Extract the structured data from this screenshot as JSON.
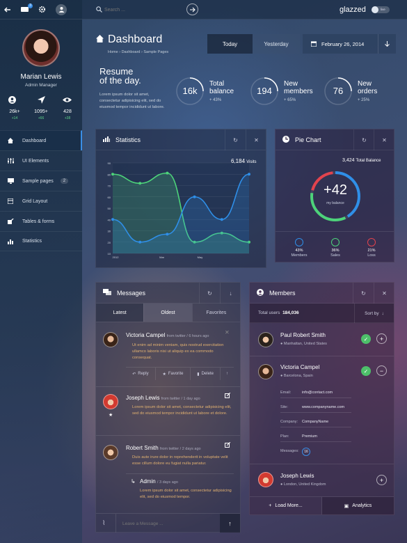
{
  "header": {
    "search_placeholder": "Search ...",
    "brand": "glazzed",
    "toggle": "live"
  },
  "sidebar": {
    "notification_count": "3",
    "user": {
      "name": "Marian Lewis",
      "role": "Admin Manager"
    },
    "stats": [
      {
        "value": "26k+",
        "delta": "+14"
      },
      {
        "value": "1095+",
        "delta": "+66"
      },
      {
        "value": "428",
        "delta": "+38"
      }
    ],
    "menu": [
      {
        "label": "Dashboard",
        "active": true
      },
      {
        "label": "UI Elements"
      },
      {
        "label": "Sample pages",
        "badge": "2"
      },
      {
        "label": "Grid Layout"
      },
      {
        "label": "Tables & forms"
      },
      {
        "label": "Statistics"
      }
    ]
  },
  "page": {
    "title": "Dashboard",
    "breadcrumb": [
      "Home",
      "Dashboard",
      "Sample Pages"
    ]
  },
  "date_tabs": {
    "today": "Today",
    "yesterday": "Yesterday",
    "date": "February 26, 2014"
  },
  "resume": {
    "title_1": "Resume",
    "title_2": "of the day.",
    "text": "Lorem ipsum dolor sit amet, consectetur adipisicing elit, sed do eiusmod tempor incididunt ut labore."
  },
  "kpis": [
    {
      "value": "16k",
      "label_1": "Total",
      "label_2": "balance",
      "delta": "+ 43%"
    },
    {
      "value": "194",
      "label_1": "New",
      "label_2": "members",
      "delta": "+ 65%"
    },
    {
      "value": "76",
      "label_1": "New",
      "label_2": "orders",
      "delta": "+ 25%"
    }
  ],
  "statistics": {
    "title": "Statistics",
    "visits_value": "6,184",
    "visits_label": "Visits"
  },
  "chart_data": {
    "type": "area",
    "title": "",
    "xlabel": "",
    "ylabel": "",
    "ylim": [
      10,
      90
    ],
    "yticks": [
      10,
      20,
      30,
      40,
      50,
      60,
      70,
      80,
      90
    ],
    "x_tick_labels": [
      "2012",
      "Mar",
      "May"
    ],
    "x": [
      0,
      1,
      2,
      3,
      4,
      5
    ],
    "series": [
      {
        "name": "",
        "color": "#4dd37a",
        "values": [
          80,
          72,
          81,
          20,
          28,
          20
        ]
      },
      {
        "name": "",
        "color": "#2f8fe8",
        "values": [
          40,
          20,
          27,
          60,
          40,
          80
        ]
      }
    ],
    "grid": true
  },
  "pie": {
    "title": "Pie Chart",
    "total_value": "3,424",
    "total_label": "Total Balance",
    "center_value": "+42",
    "center_label": "my balance",
    "segments": [
      {
        "name": "Members",
        "percent": 43,
        "color": "#2f8fe8"
      },
      {
        "name": "Sales",
        "percent": 36,
        "color": "#4dd37a"
      },
      {
        "name": "Loss",
        "percent": 21,
        "color": "#e2434d"
      }
    ],
    "legend": [
      {
        "pct": "43%",
        "name": "Members",
        "color": "#2f8fe8"
      },
      {
        "pct": "36%",
        "name": "Sales",
        "color": "#4dd37a"
      },
      {
        "pct": "21%",
        "name": "Loss",
        "color": "#e2434d"
      }
    ]
  },
  "messages": {
    "title": "Messages",
    "tabs": [
      "Latest",
      "Oldest",
      "Favorites"
    ],
    "items": [
      {
        "name": "Victoria Campel",
        "meta": "from twitter / 6 hours ago",
        "text": "Ut enim ad minim veniam, quis nostrud exercitation ullamco laboris nisi ut aliquip ex ea commodo consequat."
      },
      {
        "name": "Joseph Lewis",
        "meta": "from twitter / 1 day ago",
        "text": "Lorem ipsum dolor sit amet, consectetur adipisicing elit, sed do eiusmod tempor incididunt ut labore et dolore."
      },
      {
        "name": "Robert Smith",
        "meta": "from twitter / 2 days ago",
        "text": "Duis aute irure dolor in reprehenderit in voluptate velit esse cillum dolore eu fugiat nulla pariatur."
      }
    ],
    "actions": {
      "reply": "Reply",
      "favorite": "Favorite",
      "delete": "Delete"
    },
    "reply": {
      "name": "Admin",
      "meta": "/ 3 days ago",
      "text": "Lorem ipsum dolor sit amet, consectetur adipisicing elit, sed do eiusmod tempor."
    },
    "input_placeholder": "Leave a Message ..."
  },
  "members": {
    "title": "Members",
    "total_label": "Total users",
    "total_value": "184,036",
    "sort_label": "Sort by",
    "items": [
      {
        "name": "Paul Robert Smith",
        "location": "Manhattan, United States"
      },
      {
        "name": "Victoria Campel",
        "location": "Barcelona, Spain"
      },
      {
        "name": "Joseph Lewis",
        "location": "London, United Kingdom"
      }
    ],
    "details": [
      {
        "label": "Email:",
        "value": "info@contact.com"
      },
      {
        "label": "Site:",
        "value": "www.companyname.com"
      },
      {
        "label": "Company:",
        "value": "CompanyName"
      },
      {
        "label": "Plan:",
        "value": "Premium"
      },
      {
        "label": "Messages:",
        "value": "16"
      }
    ],
    "load_more": "Load More...",
    "analytics": "Analytics"
  }
}
